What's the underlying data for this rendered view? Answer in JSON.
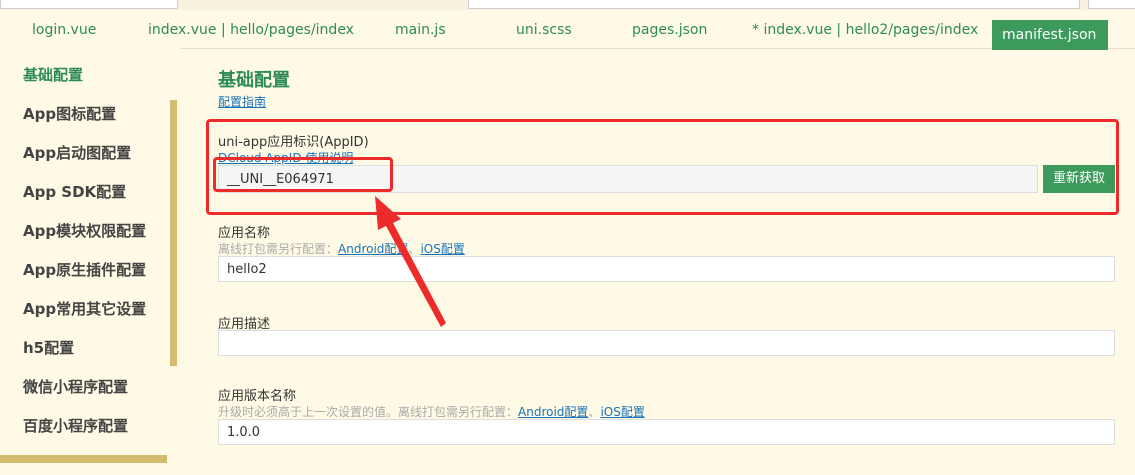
{
  "tabs": [
    {
      "label": "login.vue"
    },
    {
      "label": "index.vue | hello/pages/index"
    },
    {
      "label": "main.js"
    },
    {
      "label": "uni.scss"
    },
    {
      "label": "pages.json"
    },
    {
      "label": "* index.vue | hello2/pages/index"
    },
    {
      "label": "manifest.json"
    }
  ],
  "sidebar": {
    "items": [
      {
        "label": "基础配置"
      },
      {
        "label": "App图标配置"
      },
      {
        "label": "App启动图配置"
      },
      {
        "label": "App SDK配置"
      },
      {
        "label": "App模块权限配置"
      },
      {
        "label": "App原生插件配置"
      },
      {
        "label": "App常用其它设置"
      },
      {
        "label": "h5配置"
      },
      {
        "label": "微信小程序配置"
      },
      {
        "label": "百度小程序配置"
      }
    ]
  },
  "main": {
    "title": "基础配置",
    "guide_link": "配置指南",
    "appid": {
      "label": "uni-app应用标识(AppID)",
      "help_link": "DCloud AppID 使用说明",
      "value": "__UNI__E064971",
      "button": "重新获取"
    },
    "app_name": {
      "label": "应用名称",
      "hint_prefix": "离线打包需另行配置：",
      "android_link": "Android配置",
      "separator": "、",
      "ios_link": "iOS配置",
      "value": "hello2"
    },
    "app_desc": {
      "label": "应用描述",
      "value": ""
    },
    "version_name": {
      "label": "应用版本名称",
      "hint_prefix": "升级时必须高于上一次设置的值。离线打包需另行配置：",
      "android_link": "Android配置",
      "separator": "、",
      "ios_link": "iOS配置",
      "value": "1.0.0"
    }
  },
  "colors": {
    "accent": "#3c9b5c",
    "annotation": "#ee2b2b",
    "background": "#fffae6"
  },
  "annotation": {
    "type": "red-arrow-pointing-to-appid"
  }
}
